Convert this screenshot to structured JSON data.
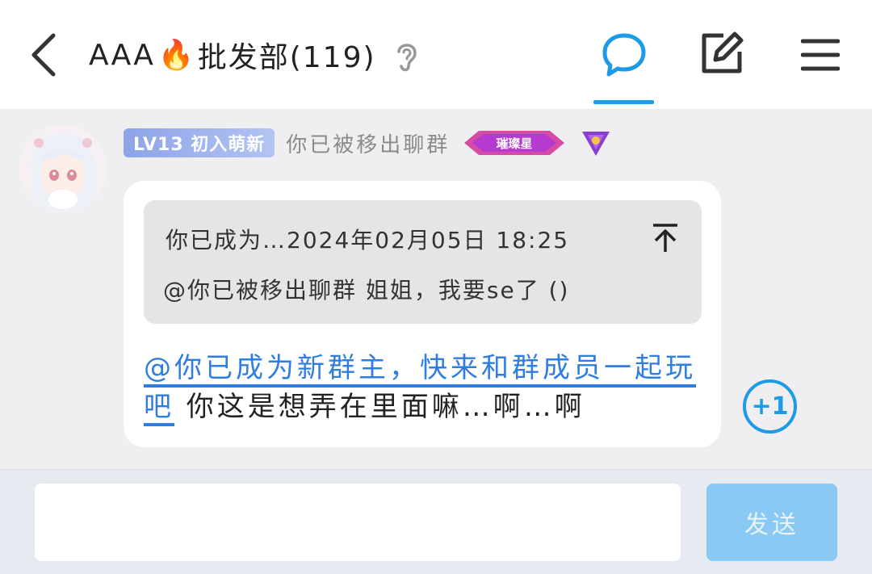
{
  "header": {
    "title_prefix": "AAA",
    "title_emoji": "🔥",
    "title_main": "批发部(119)",
    "icons": {
      "back": "chevron-left-icon",
      "ear": "ear-icon",
      "chat": "chat-bubble-icon",
      "edit": "edit-icon",
      "menu": "menu-icon"
    },
    "accent_color": "#1e9be6"
  },
  "message": {
    "level_badge": "LV13 初入萌新",
    "sender_name": "你已被移出聊群",
    "rank_badge_text": "璀璨星",
    "quote": {
      "header": "你已成为…2024年02月05日 18:25",
      "body": "@你已被移出聊群 姐姐，我要se了 ()"
    },
    "mention": "@你已成为新群主，快来和群成员一起玩吧",
    "text": " 你这是想弄在里面嘛…啊…啊",
    "reaction": "+1"
  },
  "composer": {
    "input_value": "",
    "send_label": "发送"
  }
}
